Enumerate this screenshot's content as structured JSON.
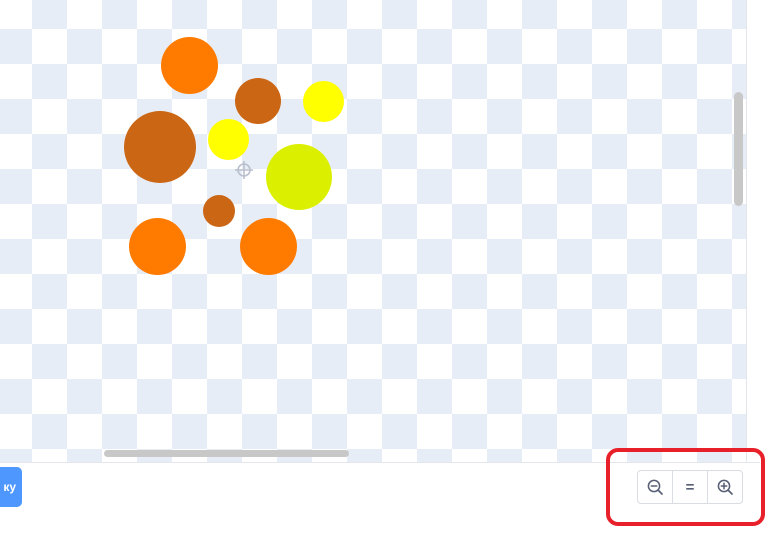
{
  "toolbar": {
    "action_button_label": "ку"
  },
  "zoom": {
    "zoom_out_icon": "zoom-out-icon",
    "reset_icon": "equals-icon",
    "zoom_in_icon": "zoom-in-icon",
    "reset_symbol": "="
  },
  "colors": {
    "orange": "#ff7b00",
    "brown": "#cb6614",
    "yellow": "#ffff00",
    "lime": "#dbf000",
    "accent_button": "#4d97ff",
    "highlight": "#e8202a",
    "checker": "#e7edf6"
  }
}
